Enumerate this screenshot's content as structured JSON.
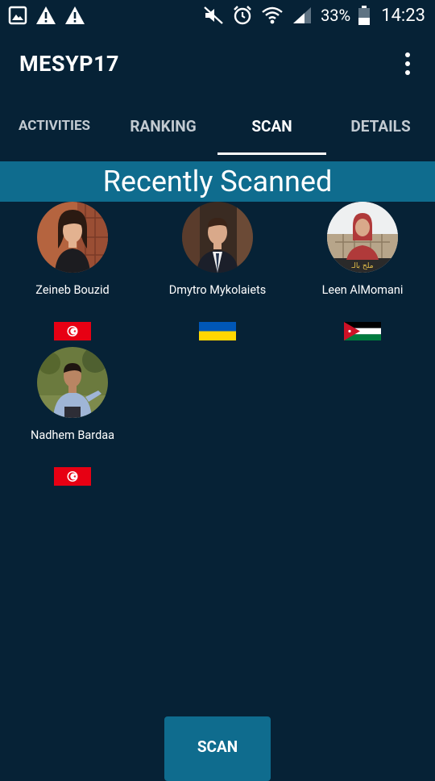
{
  "status_bar": {
    "battery": "33%",
    "time": "14:23",
    "icons": [
      "gallery-icon",
      "warning-icon",
      "warning-icon",
      "mute-icon",
      "alarm-icon",
      "wifi-icon",
      "signal-icon",
      "battery-icon"
    ]
  },
  "app": {
    "title": "MESYP17"
  },
  "tabs": [
    {
      "label": "ACTIVITIES",
      "active": false
    },
    {
      "label": "RANKING",
      "active": false
    },
    {
      "label": "SCAN",
      "active": true
    },
    {
      "label": "DETAILS",
      "active": false
    }
  ],
  "section": {
    "title": "Recently Scanned"
  },
  "people": [
    {
      "name": "Zeineb Bouzid",
      "flag": "tunisia-flag-icon"
    },
    {
      "name": "Dmytro Mykolaiets",
      "flag": "ukraine-flag-icon"
    },
    {
      "name": "Leen AlMomani",
      "flag": "jordan-flag-icon"
    },
    {
      "name": "Nadhem Bardaa",
      "flag": "tunisia-flag-icon"
    }
  ],
  "scan_button": {
    "label": "SCAN"
  },
  "colors": {
    "background": "#062236",
    "accent": "#0f6c8e",
    "tab_inactive": "#c2cad1"
  }
}
